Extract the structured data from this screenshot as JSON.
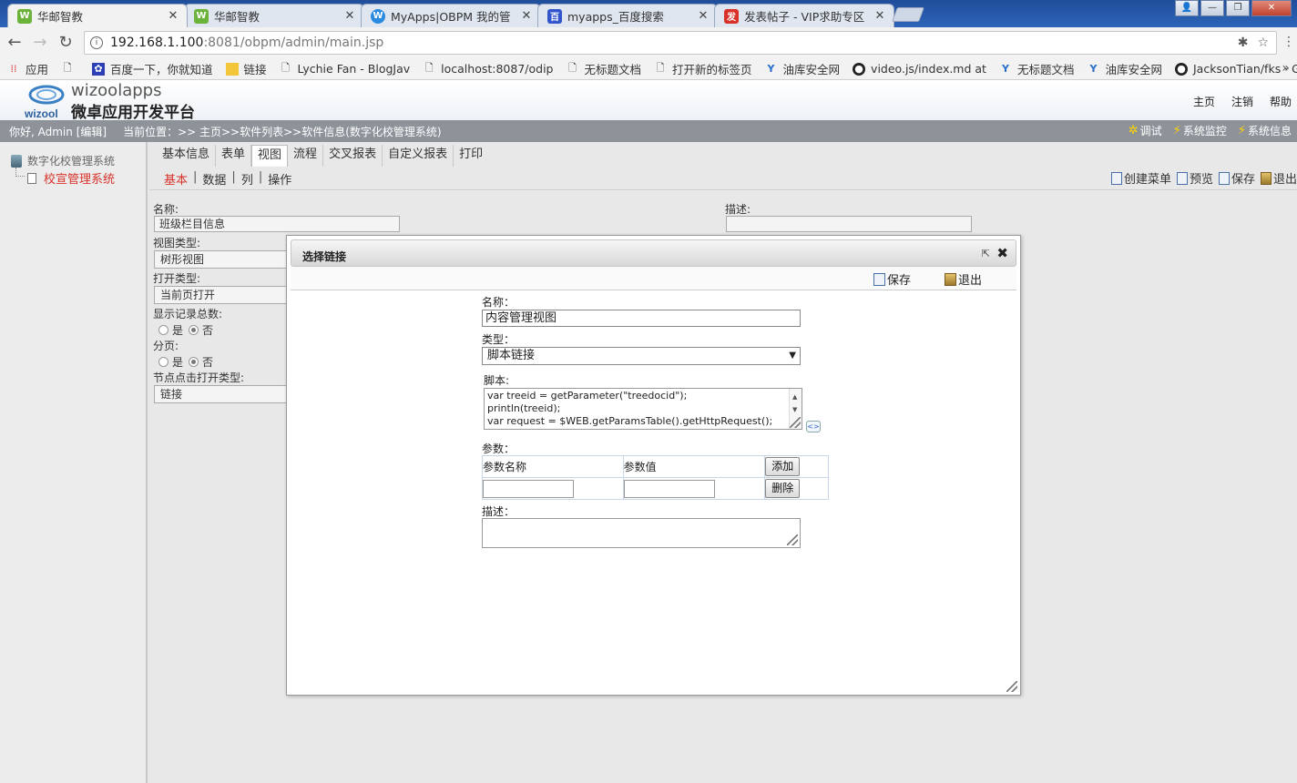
{
  "browser": {
    "tabs": [
      {
        "title": "华邮智教",
        "favicon": "W",
        "color": "#6bb33a",
        "active": true
      },
      {
        "title": "华邮智教",
        "favicon": "W",
        "color": "#6bb33a",
        "active": false
      },
      {
        "title": "MyApps|OBPM 我的管",
        "favicon": "W",
        "color": "#2b8be0",
        "active": false
      },
      {
        "title": "myapps_百度搜索",
        "favicon": "百",
        "color": "#3355cc",
        "active": false
      },
      {
        "title": "发表帖子 - VIP求助专区",
        "favicon": "发",
        "color": "#d9322b",
        "active": false
      }
    ],
    "url_host": "192.168.1.100",
    "url_rest": ":8081/obpm/admin/main.jsp",
    "bookmarks": [
      {
        "label": "应用",
        "icon": "apps-grid-icon"
      },
      {
        "label": "",
        "icon": "page-icon"
      },
      {
        "label": "百度一下，你就知道",
        "icon": "baidu-paw-icon"
      },
      {
        "label": "链接",
        "icon": "folder-icon"
      },
      {
        "label": "Lychie Fan - BlogJav",
        "icon": "page-icon"
      },
      {
        "label": "localhost:8087/odip",
        "icon": "page-icon"
      },
      {
        "label": "无标题文档",
        "icon": "page-icon"
      },
      {
        "label": "打开新的标签页",
        "icon": "page-icon"
      },
      {
        "label": "油库安全网",
        "icon": "y-icon"
      },
      {
        "label": "video.js/index.md at",
        "icon": "github-icon"
      },
      {
        "label": "无标题文档",
        "icon": "y-icon"
      },
      {
        "label": "油库安全网",
        "icon": "y-icon"
      },
      {
        "label": "JacksonTian/fks · Git",
        "icon": "github-icon"
      }
    ]
  },
  "header": {
    "brand_en": "wizoolapps",
    "brand_cn": "微卓应用开发平台",
    "logo_text": "wizool",
    "links": [
      "主页",
      "注销",
      "帮助"
    ]
  },
  "status": {
    "user": "你好, Admin [编辑]",
    "breadcrumb": "当前位置：>> 主页>>软件列表>>软件信息(数字化校管理系统)",
    "tools": [
      "调试",
      "系统监控",
      "系统信息"
    ]
  },
  "tree": {
    "root": "数字化校管理系统",
    "child": "校宣管理系统"
  },
  "tabs": [
    "基本信息",
    "表单",
    "视图",
    "流程",
    "交叉报表",
    "自定义报表",
    "打印"
  ],
  "active_tab": "视图",
  "subtabs": [
    "基本",
    "数据",
    "列",
    "操作"
  ],
  "actions": [
    "创建菜单",
    "预览",
    "保存",
    "退出"
  ],
  "form": {
    "name_label": "名称:",
    "name_value": "班级栏目信息",
    "desc_label": "描述:",
    "viewtype_label": "视图类型:",
    "viewtype_value": "树形视图",
    "opentype_label": "打开类型:",
    "opentype_value": "当前页打开",
    "showcount_label": "显示记录总数:",
    "paging_label": "分页:",
    "yes": "是",
    "no": "否",
    "nodeclick_label": "节点点击打开类型:",
    "nodeclick_value": "链接"
  },
  "dialog": {
    "title": "选择链接",
    "save": "保存",
    "exit": "退出",
    "name_label": "名称：",
    "name_value": "内容管理视图",
    "type_label": "类型：",
    "type_value": "脚本链接",
    "script_label": "脚本:",
    "script_lines": [
      "var treeid = getParameter(\"treedocid\");",
      "println(treeid);",
      "var request = $WEB.getParamsTable().getHttpRequest();"
    ],
    "params_label": "参数：",
    "param_name_header": "参数名称",
    "param_value_header": "参数值",
    "add_button": "添加",
    "delete_button": "删除",
    "desc_label": "描述："
  }
}
